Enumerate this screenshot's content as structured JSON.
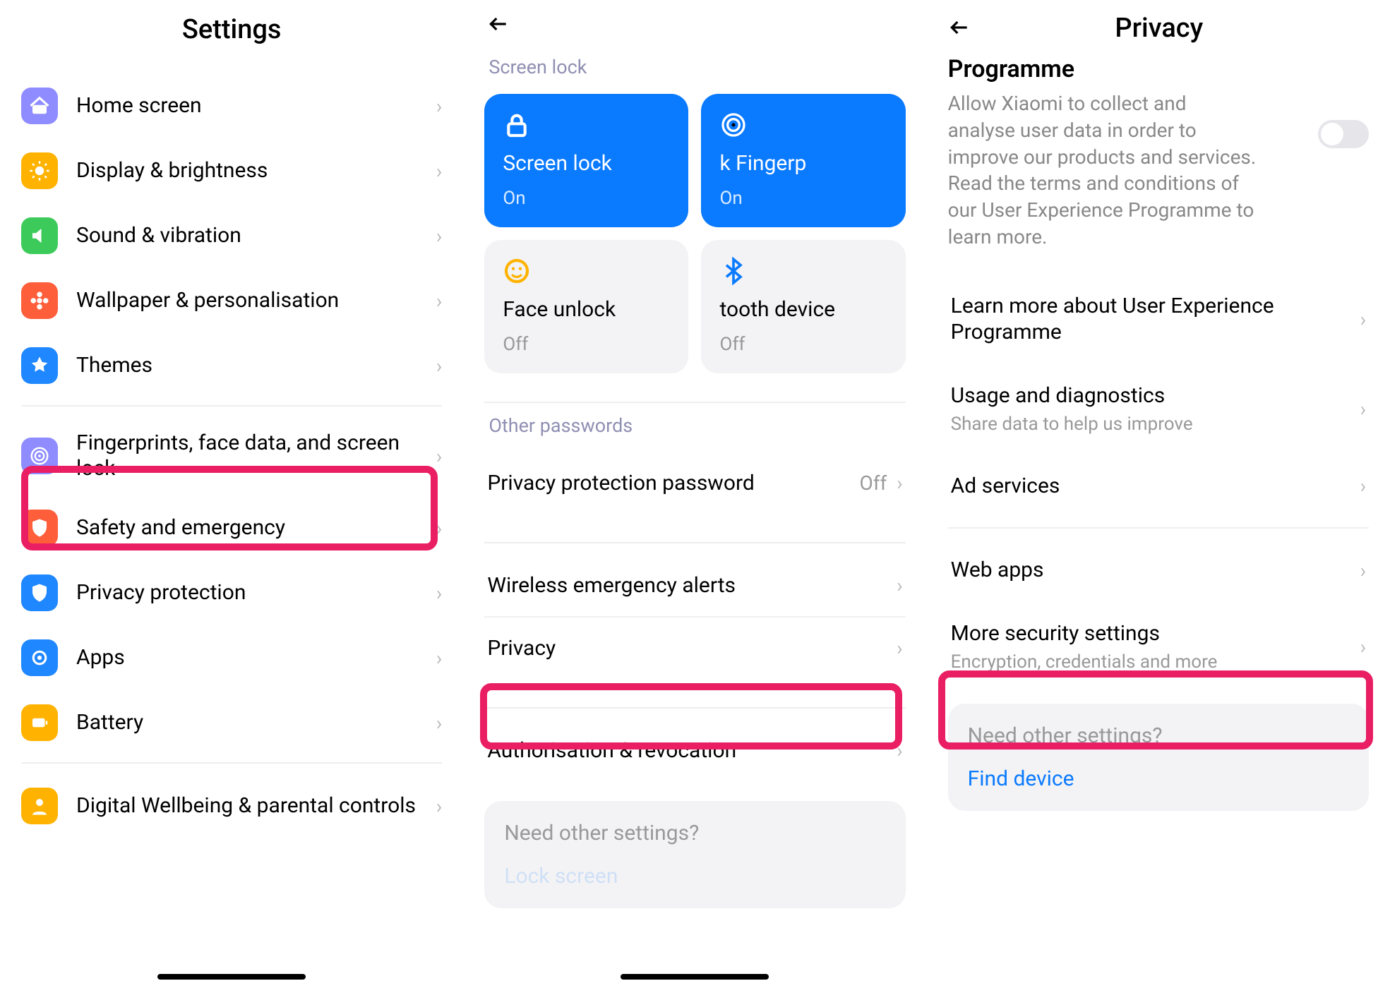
{
  "screen1": {
    "title": "Settings",
    "items": [
      {
        "label": "Home screen",
        "iconColor": "#8e8cff",
        "icon": "home"
      },
      {
        "label": "Display & brightness",
        "iconColor": "#ffb300",
        "icon": "sun"
      },
      {
        "label": "Sound & vibration",
        "iconColor": "#3ccb5a",
        "icon": "sound"
      },
      {
        "label": "Wallpaper & personalisation",
        "iconColor": "#ff5e3a",
        "icon": "flower"
      },
      {
        "label": "Themes",
        "iconColor": "#1f87ff",
        "icon": "paint"
      }
    ],
    "spacer1": true,
    "group2": [
      {
        "label": "Fingerprints, face data, and screen lock",
        "iconColor": "#8e8cff",
        "icon": "fingerprint",
        "highlighted": true
      },
      {
        "label": "Safety and emergency",
        "iconColor": "#ff5e3a",
        "icon": "shield"
      },
      {
        "label": "Privacy protection",
        "iconColor": "#1f87ff",
        "icon": "shieldblue"
      },
      {
        "label": "Apps",
        "iconColor": "#1f87ff",
        "icon": "apps"
      },
      {
        "label": "Battery",
        "iconColor": "#ffb300",
        "icon": "battery"
      }
    ],
    "spacer2": true,
    "group3": [
      {
        "label": "Digital Wellbeing & parental controls",
        "iconColor": "#ffb300",
        "icon": "wellbeing"
      }
    ]
  },
  "screen2": {
    "section_screen_lock": "Screen lock",
    "cards": [
      {
        "title": "Screen lock",
        "status": "On",
        "style": "blue",
        "icon": "lock"
      },
      {
        "title": "k        Fingerp",
        "status": "On",
        "style": "blue",
        "icon": "fingerprint"
      },
      {
        "title": "Face unlock",
        "status": "Off",
        "style": "gray",
        "icon": "smile"
      },
      {
        "title": "tooth device",
        "status": "Off",
        "style": "gray",
        "icon": "bluetooth"
      }
    ],
    "section_other_passwords": "Other passwords",
    "rows_group1": [
      {
        "label": "Privacy protection password",
        "value": "Off"
      }
    ],
    "rows_group2": [
      {
        "label": "Wireless emergency alerts"
      },
      {
        "label": "Privacy",
        "highlighted": true
      }
    ],
    "rows_group3": [
      {
        "label": "Authorisation & revocation"
      }
    ],
    "need_title": "Need other settings?",
    "need_link": "Lock screen"
  },
  "screen3": {
    "title": "Privacy",
    "programme_heading": "Programme",
    "programme_desc": "Allow Xiaomi to collect and analyse user data in order to improve our products and services. Read the terms and conditions of our User Experience Programme to learn more.",
    "toggle_on": false,
    "items": [
      {
        "label": "Learn more about User Experience Programme"
      },
      {
        "label": "Usage and diagnostics",
        "sub": "Share data to help us improve"
      },
      {
        "label": "Ad services"
      }
    ],
    "items2": [
      {
        "label": "Web apps"
      },
      {
        "label": "More security settings",
        "sub": "Encryption, credentials and more",
        "highlighted": true
      }
    ],
    "need_title": "Need other settings?",
    "need_link": "Find device"
  }
}
